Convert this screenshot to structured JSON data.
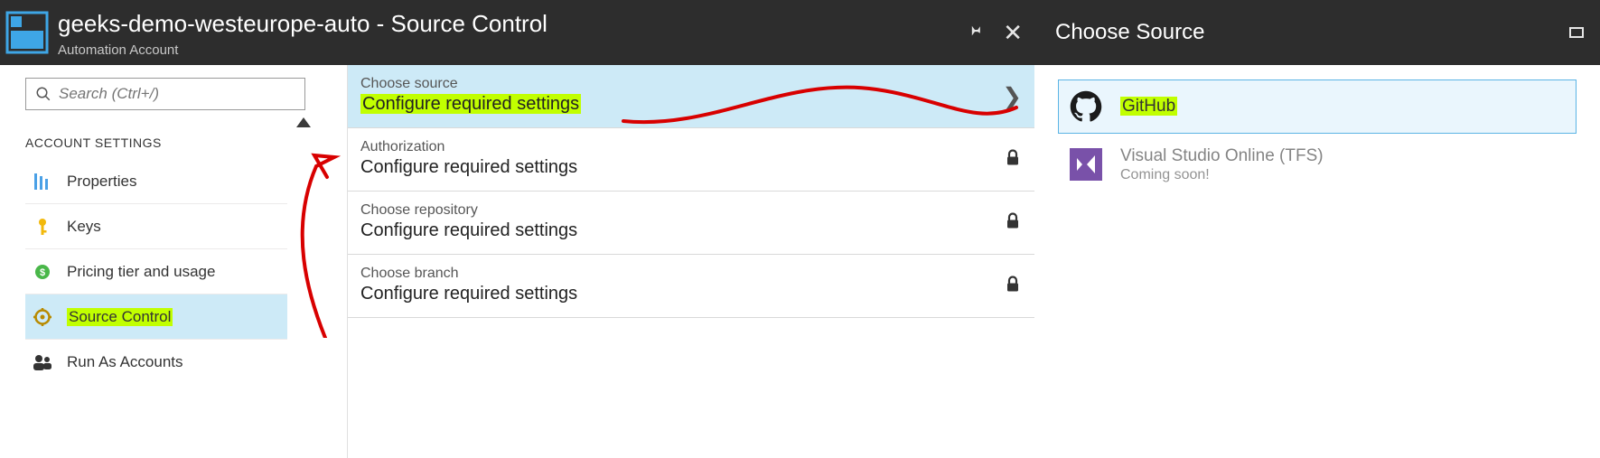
{
  "header": {
    "title": "geeks-demo-westeurope-auto - Source Control",
    "subtitle": "Automation Account",
    "right_panel_title": "Choose Source"
  },
  "sidebar": {
    "search_placeholder": "Search (Ctrl+/)",
    "section_label": "ACCOUNT SETTINGS",
    "items": [
      {
        "label": "Properties"
      },
      {
        "label": "Keys"
      },
      {
        "label": "Pricing tier and usage"
      },
      {
        "label": "Source Control"
      },
      {
        "label": "Run As Accounts"
      }
    ]
  },
  "settings": [
    {
      "label": "Choose source",
      "value": "Configure required settings",
      "highlighted": true,
      "chevron": true,
      "locked": false
    },
    {
      "label": "Authorization",
      "value": "Configure required settings",
      "highlighted": false,
      "chevron": false,
      "locked": true
    },
    {
      "label": "Choose repository",
      "value": "Configure required settings",
      "highlighted": false,
      "chevron": false,
      "locked": true
    },
    {
      "label": "Choose branch",
      "value": "Configure required settings",
      "highlighted": false,
      "chevron": false,
      "locked": true
    }
  ],
  "sources": [
    {
      "name": "GitHub",
      "sub": "",
      "selected": true,
      "highlight_name": true,
      "disabled": false
    },
    {
      "name": "Visual Studio Online (TFS)",
      "sub": "Coming soon!",
      "selected": false,
      "highlight_name": false,
      "disabled": true
    }
  ]
}
